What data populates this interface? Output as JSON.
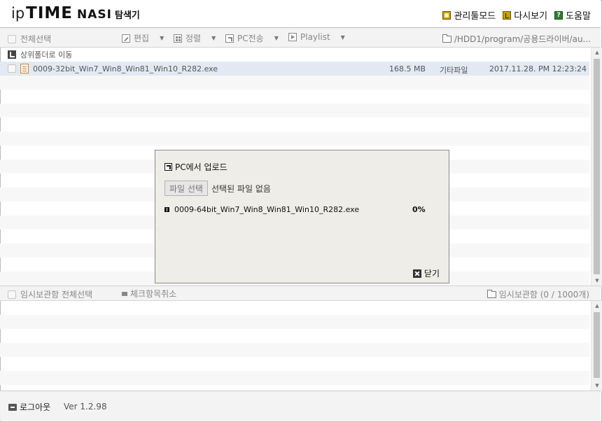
{
  "header": {
    "logo_ip": "ip",
    "logo_time": "TIME",
    "logo_nas": "NASI",
    "logo_explorer": "탐색기",
    "nav": [
      {
        "label": "관리툴모드",
        "icon": "admin-tool-icon"
      },
      {
        "label": "다시보기",
        "icon": "reload-icon"
      },
      {
        "label": "도움말",
        "icon": "help-icon"
      }
    ]
  },
  "toolbar": {
    "select_all": "전체선택",
    "edit": "편집",
    "sort": "정렬",
    "pc_transfer": "PC전송",
    "playlist": "Playlist",
    "path": "/HDD1/program/공용드라이버/au..."
  },
  "filelist": {
    "up_folder": "상위폴더로 이동",
    "files": [
      {
        "name": "0009-32bit_Win7_Win8_Win81_Win10_R282.exe",
        "size": "168.5 MB",
        "type": "기타파일",
        "date": "2017.11.28. PM 12:23:24"
      }
    ]
  },
  "tempbox": {
    "select_all": "임시보관함 전체선택",
    "uncheck": "체크항목취소",
    "label": "임시보관함 (0 / 1000개)"
  },
  "footer": {
    "logout": "로그아웃",
    "version": "Ver 1.2.98"
  },
  "dialog": {
    "title": "PC에서 업로드",
    "pick_button": "파일 선택",
    "no_file": "선택된 파일 없음",
    "upload": {
      "name": "0009-64bit_Win7_Win8_Win81_Win10_R282.exe",
      "percent": "0%"
    },
    "close": "닫기"
  },
  "colors": {
    "selected_row": "#e2e9f2",
    "dialog_bg": "#efede7",
    "help_green": "#2e7d32",
    "admin_gold": "#c8a000"
  }
}
